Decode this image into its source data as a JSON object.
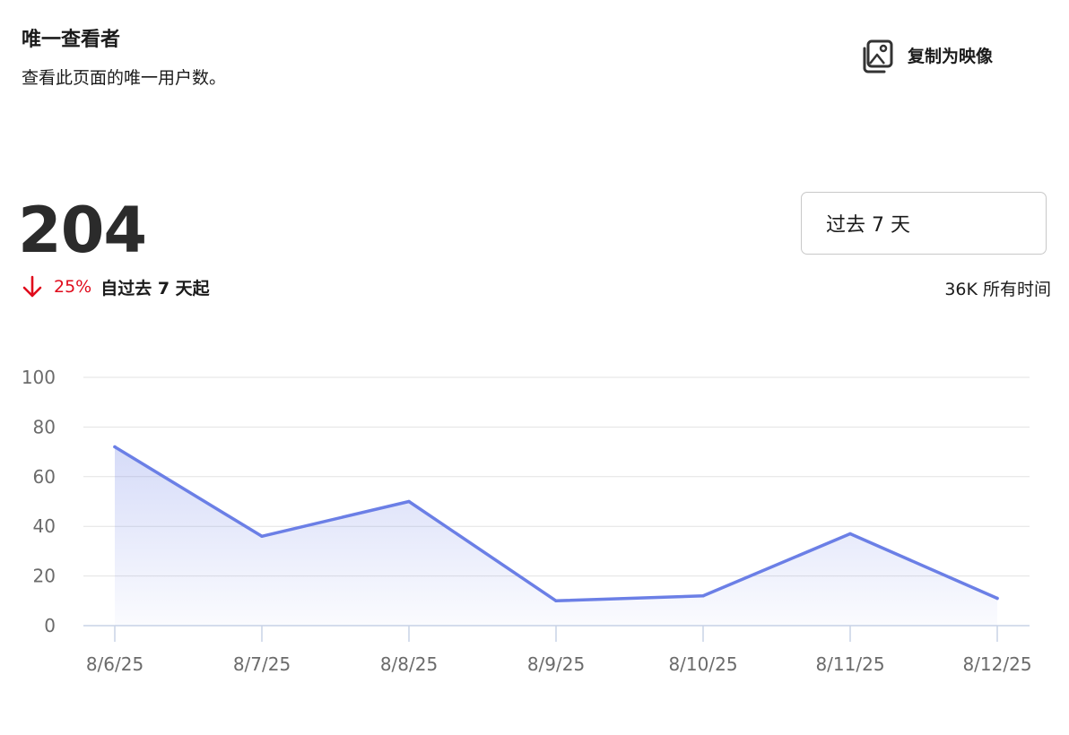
{
  "header": {
    "title": "唯一查看者",
    "subtitle": "查看此页面的唯一用户数。"
  },
  "toolbar": {
    "copy_label": "复制为映像",
    "copy_icon": "image-icon"
  },
  "summary": {
    "value": "204",
    "change_icon": "arrow-down-icon",
    "change_percent": "25%",
    "change_caption": "自过去 7 天起",
    "change_color": "#e00b1c"
  },
  "range": {
    "selected": "过去 7 天",
    "all_time": "36K 所有时间"
  },
  "chart_data": {
    "type": "area",
    "x": [
      "8/6/25",
      "8/7/25",
      "8/8/25",
      "8/9/25",
      "8/10/25",
      "8/11/25",
      "8/12/25"
    ],
    "series": [
      {
        "values": [
          72,
          36,
          50,
          10,
          12,
          37,
          11
        ],
        "color": "#6b7fe6"
      }
    ],
    "yticks": [
      0,
      20,
      40,
      60,
      80,
      100
    ],
    "ylim": [
      0,
      100
    ],
    "grid": true,
    "title": "",
    "xlabel": "",
    "ylabel": ""
  }
}
